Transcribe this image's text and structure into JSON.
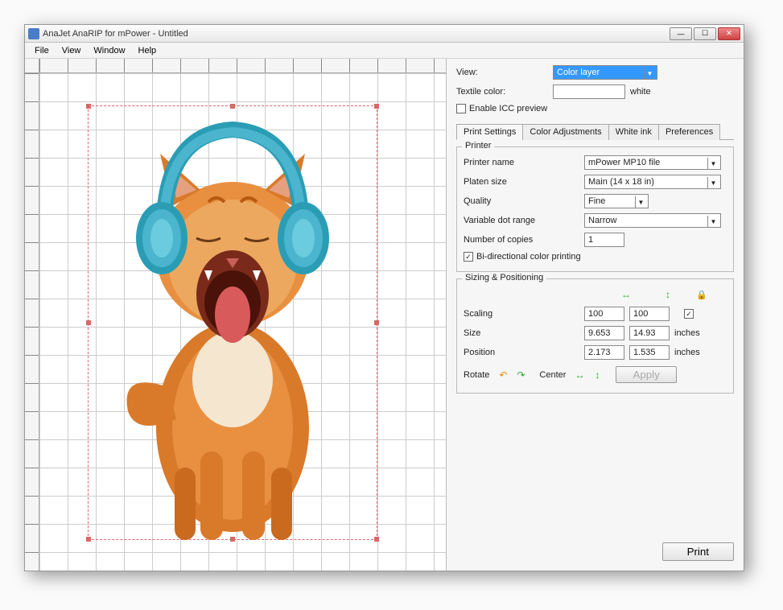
{
  "window": {
    "title": "AnaJet AnaRIP for mPower - Untitled"
  },
  "menu": {
    "file": "File",
    "view": "View",
    "window": "Window",
    "help": "Help"
  },
  "topPanel": {
    "view_label": "View:",
    "view_value": "Color layer",
    "textile_label": "Textile color:",
    "textile_value": "white",
    "icc_checkbox": "Enable ICC preview"
  },
  "tabs": {
    "print_settings": "Print Settings",
    "color_adjustments": "Color Adjustments",
    "white_ink": "White ink",
    "preferences": "Preferences"
  },
  "printer_group": {
    "title": "Printer",
    "printer_name_label": "Printer name",
    "printer_name_value": "mPower MP10 file",
    "platen_label": "Platen size",
    "platen_value": "Main (14 x 18 in)",
    "quality_label": "Quality",
    "quality_value": "Fine",
    "variable_dot_label": "Variable dot range",
    "variable_dot_value": "Narrow",
    "copies_label": "Number of copies",
    "copies_value": "1",
    "bidir_label": "Bi-directional color printing"
  },
  "sizing_group": {
    "title": "Sizing & Positioning",
    "scaling_label": "Scaling",
    "scaling_w": "100",
    "scaling_h": "100",
    "size_label": "Size",
    "size_w": "9.653",
    "size_h": "14.93",
    "size_units": "inches",
    "position_label": "Position",
    "position_x": "2.173",
    "position_y": "1.535",
    "position_units": "inches",
    "rotate_label": "Rotate",
    "center_label": "Center",
    "apply_label": "Apply"
  },
  "print_button": "Print",
  "canvas": {
    "image_description": "Orange tabby kitten with mouth open wide wearing teal/blue over-ear headphones"
  }
}
